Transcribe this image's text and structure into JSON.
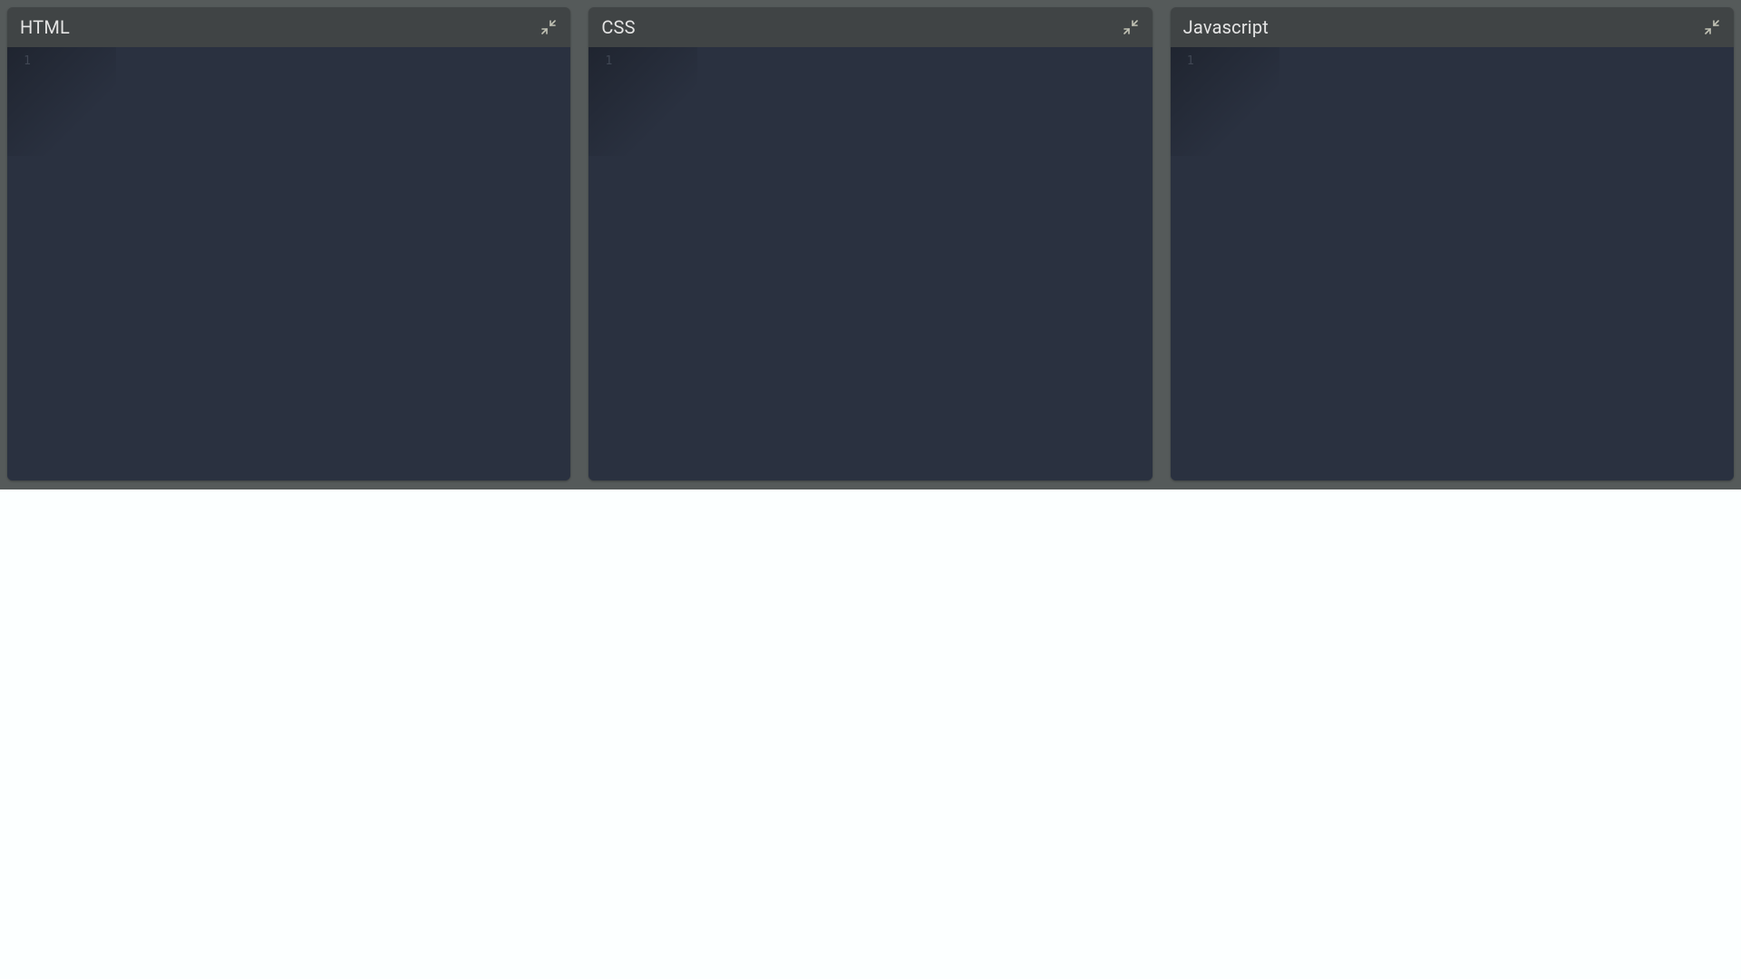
{
  "panels": [
    {
      "title": "HTML",
      "line_start": "1",
      "code": ""
    },
    {
      "title": "CSS",
      "line_start": "1",
      "code": ""
    },
    {
      "title": "Javascript",
      "line_start": "1",
      "code": ""
    }
  ],
  "icons": {
    "compress": "compress-icon"
  }
}
